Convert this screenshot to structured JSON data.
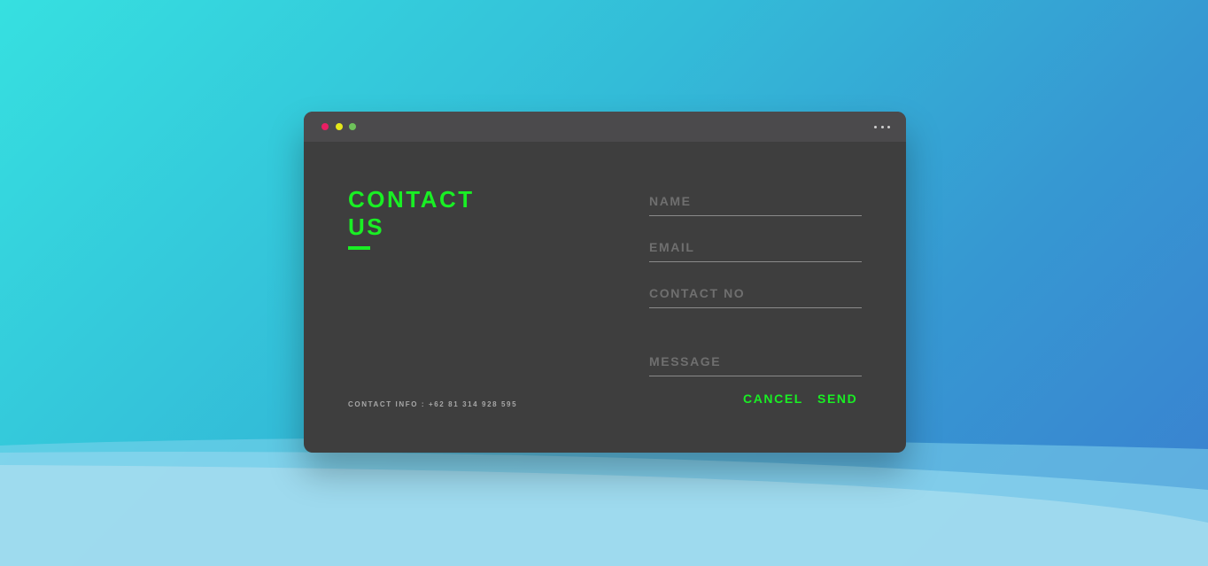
{
  "window": {
    "title_lines": [
      "CONTACT",
      "US"
    ],
    "contact_info": "CONTACT INFO : +62 81 314 928 595",
    "menu_icon": "more-horizontal-icon"
  },
  "form": {
    "name_placeholder": "NAME",
    "email_placeholder": "EMAIL",
    "contact_placeholder": "CONTACT NO",
    "message_placeholder": "MESSAGE",
    "cancel_label": "CANCEL",
    "send_label": "SEND"
  },
  "colors": {
    "accent": "#19ef24",
    "panel": "#3e3e3e",
    "titlebar": "#4b4a4c",
    "dot_red": "#e91e63",
    "dot_yellow": "#e5e81a",
    "dot_green": "#6ec25a"
  }
}
